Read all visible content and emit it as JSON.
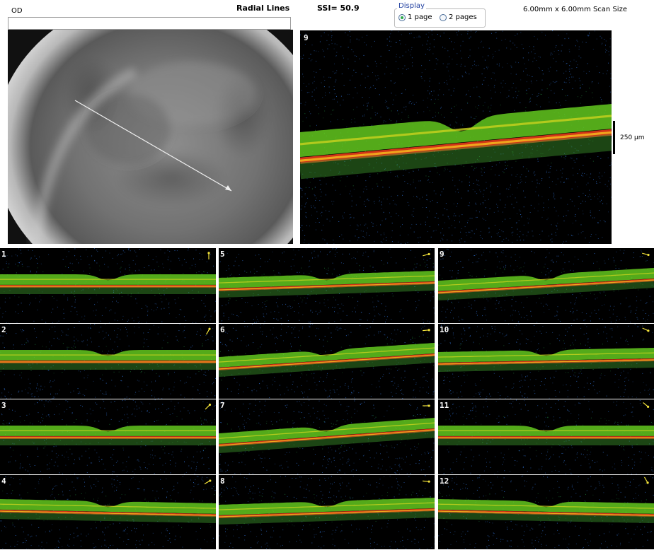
{
  "header": {
    "eye": "OD",
    "scan_mode": "Radial Lines",
    "ssi": "SSI= 50.9",
    "scan_size": "6.00mm x 6.00mm Scan Size"
  },
  "display": {
    "legend": "Display",
    "options": [
      {
        "label": "1 page",
        "selected": true
      },
      {
        "label": "2 pages",
        "selected": false
      }
    ]
  },
  "main_scan": {
    "label": "9"
  },
  "scale": {
    "label": "250 µm"
  },
  "thumbnails": [
    {
      "label": "1"
    },
    {
      "label": "2"
    },
    {
      "label": "3"
    },
    {
      "label": "4"
    },
    {
      "label": "5"
    },
    {
      "label": "6"
    },
    {
      "label": "7"
    },
    {
      "label": "8"
    },
    {
      "label": "9"
    },
    {
      "label": "10"
    },
    {
      "label": "11"
    },
    {
      "label": "12"
    }
  ],
  "colors": {
    "rpe": "#e83b1a",
    "retina": "#63c81e",
    "speckle": "#2f6fd0",
    "arrow": "#f2e23a"
  },
  "icons": {
    "fundus_scan_line": "arrow-line-icon",
    "thumb_direction": "direction-arrow-icon"
  }
}
